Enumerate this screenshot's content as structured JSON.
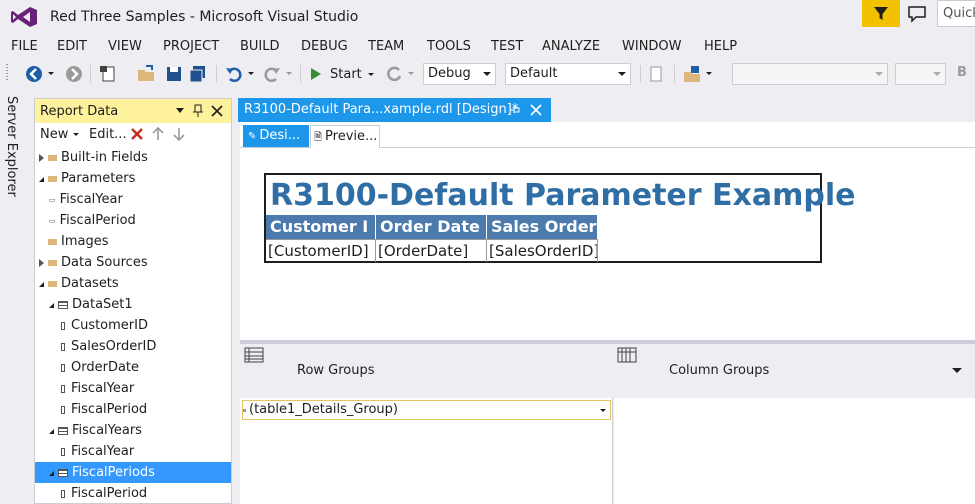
{
  "window": {
    "title": "Red Three Samples - Microsoft Visual Studio",
    "quick_launch": "Quick"
  },
  "menu": [
    "FILE",
    "EDIT",
    "VIEW",
    "PROJECT",
    "BUILD",
    "DEBUG",
    "TEAM",
    "TOOLS",
    "TEST",
    "ANALYZE",
    "WINDOW",
    "HELP"
  ],
  "toolbar": {
    "start_label": "Start",
    "config_value": "Debug",
    "platform_value": "Default",
    "overflow_label": "B"
  },
  "side_tab": {
    "label": "Server Explorer"
  },
  "report_data": {
    "title": "Report Data",
    "new_label": "New",
    "edit_label": "Edit...",
    "tree": [
      {
        "label": "Built-in Fields",
        "kind": "folder",
        "state": "closed",
        "level": 0
      },
      {
        "label": "Parameters",
        "kind": "folder",
        "state": "open",
        "level": 0
      },
      {
        "label": "FiscalYear",
        "kind": "param",
        "level": 1
      },
      {
        "label": "FiscalPeriod",
        "kind": "param",
        "level": 1
      },
      {
        "label": "Images",
        "kind": "folder",
        "state": "none",
        "level": 0
      },
      {
        "label": "Data Sources",
        "kind": "folder",
        "state": "closed",
        "level": 0
      },
      {
        "label": "Datasets",
        "kind": "folder",
        "state": "open",
        "level": 0
      },
      {
        "label": "DataSet1",
        "kind": "dataset",
        "state": "open",
        "level": 1
      },
      {
        "label": "CustomerID",
        "kind": "field",
        "level": 2
      },
      {
        "label": "SalesOrderID",
        "kind": "field",
        "level": 2
      },
      {
        "label": "OrderDate",
        "kind": "field",
        "level": 2
      },
      {
        "label": "FiscalYear",
        "kind": "field",
        "level": 2
      },
      {
        "label": "FiscalPeriod",
        "kind": "field",
        "level": 2
      },
      {
        "label": "FiscalYears",
        "kind": "dataset",
        "state": "open",
        "level": 1
      },
      {
        "label": "FiscalYear",
        "kind": "field",
        "level": 2
      },
      {
        "label": "FiscalPeriods",
        "kind": "dataset",
        "state": "open",
        "level": 1,
        "selected": true
      },
      {
        "label": "FiscalPeriod",
        "kind": "field",
        "level": 2
      }
    ]
  },
  "document": {
    "tab_label": "R3100-Default Para...xample.rdl [Design]*",
    "design_tab": "Desi...",
    "preview_tab": "Previe..."
  },
  "report": {
    "title": "R3100-Default Parameter Example",
    "headers": [
      "Customer I",
      "Order Date",
      "Sales Order"
    ],
    "cells": [
      "[CustomerID]",
      "[OrderDate]",
      "[SalesOrderID]"
    ]
  },
  "groups": {
    "row_label": "Row Groups",
    "col_label": "Column Groups",
    "row_item": "(table1_Details_Group)"
  },
  "colors": {
    "accent": "#1c97ea",
    "header_fill": "#4c7aad",
    "title_color": "#2f6ea5",
    "panel_header": "#fff29d",
    "selection": "#3399ff"
  }
}
